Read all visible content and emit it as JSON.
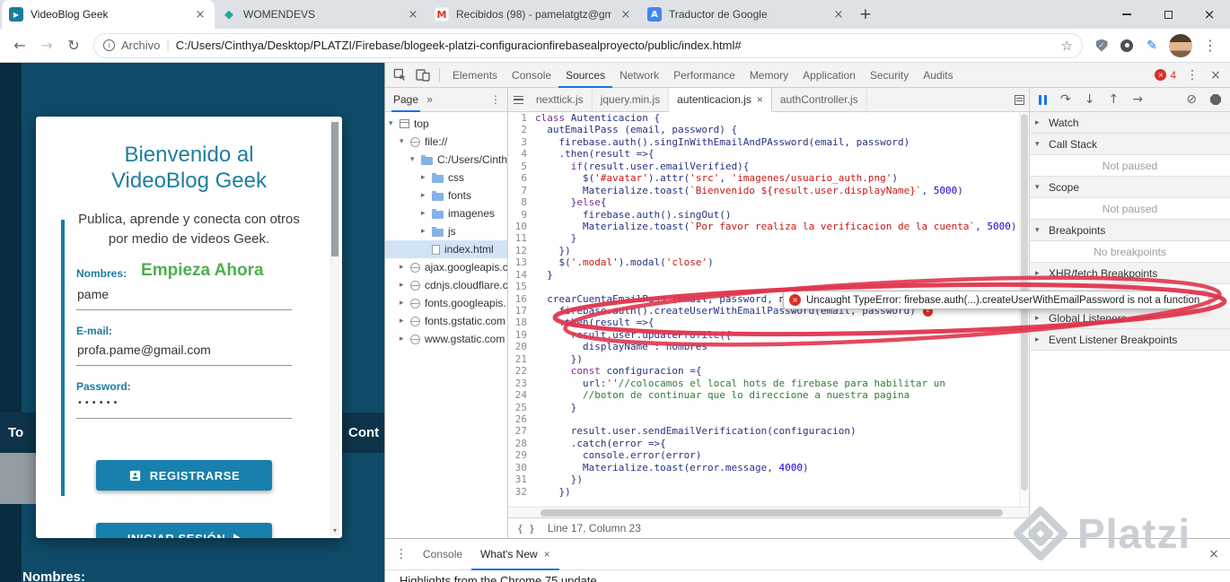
{
  "icons": {
    "back": "←",
    "forward": "→",
    "reload": "↻",
    "info": "i",
    "star": "☆",
    "kebab": "⋮",
    "cross": "×",
    "new_tab": "+",
    "overflow": "»",
    "separator": "|",
    "step_over": "↷",
    "step_into": "↓",
    "step_out": "↑",
    "step": "→",
    "deactivate": "⊘",
    "scroll_down": "▾"
  },
  "browser": {
    "tabs": [
      {
        "title": "VideoBlog Geek",
        "favicon": "videoblog",
        "glyph": "▶",
        "active": true,
        "close": "×"
      },
      {
        "title": "WOMENDEVS",
        "favicon": "womendevs",
        "glyph": "◆",
        "close": "×"
      },
      {
        "title": "Recibidos (98) - pamelatgtz@gm",
        "favicon": "gmail",
        "glyph": "M",
        "close": "×"
      },
      {
        "title": "Traductor de Google",
        "favicon": "translate",
        "glyph": "A",
        "close": "×"
      }
    ],
    "nav": {
      "scheme_label": "Archivo",
      "url": "C:/Users/Cinthya/Desktop/PLATZI/Firebase/blogeek-platzi-configuracionfirebasealproyecto/public/index.html#"
    }
  },
  "page": {
    "card": {
      "title": "Bienvenido al VideoBlog Geek",
      "subtitle": "Publica, aprende y conecta con otros por medio de videos Geek.",
      "form_heading": "Empieza Ahora",
      "nombres_label": "Nombres:",
      "nombres_value": "pame",
      "email_label": "E-mail:",
      "email_value": "profa.pame@gmail.com",
      "password_label": "Password:",
      "password_value": "••••••",
      "register_button": "REGISTRARSE",
      "login_button": "INICIAR SESIÓN"
    },
    "banners": {
      "left": "To",
      "right": "Cont",
      "bottom": "Nombres:"
    }
  },
  "devtools": {
    "main_tabs": [
      {
        "label": "Elements"
      },
      {
        "label": "Console"
      },
      {
        "label": "Sources",
        "active": true
      },
      {
        "label": "Network"
      },
      {
        "label": "Performance"
      },
      {
        "label": "Memory"
      },
      {
        "label": "Application"
      },
      {
        "label": "Security"
      },
      {
        "label": "Audits"
      }
    ],
    "error_count": "4",
    "navigator": {
      "pane_tab": "Page",
      "tree": [
        {
          "label": "top",
          "indent": 0,
          "arrow": "▾",
          "icon": "frame"
        },
        {
          "label": "file://",
          "indent": 1,
          "arrow": "▾",
          "icon": "domain"
        },
        {
          "label": "C:/Users/Cinthya",
          "indent": 2,
          "arrow": "▾",
          "icon": "folder"
        },
        {
          "label": "css",
          "indent": 3,
          "arrow": "▸",
          "icon": "folder"
        },
        {
          "label": "fonts",
          "indent": 3,
          "arrow": "▸",
          "icon": "folder"
        },
        {
          "label": "imagenes",
          "indent": 3,
          "arrow": "▸",
          "icon": "folder"
        },
        {
          "label": "js",
          "indent": 3,
          "arrow": "▸",
          "icon": "folder"
        },
        {
          "label": "index.html",
          "indent": 3,
          "arrow": "",
          "icon": "file",
          "selected": true
        },
        {
          "label": "ajax.googleapis.c...",
          "indent": 1,
          "arrow": "▸",
          "icon": "domain"
        },
        {
          "label": "cdnjs.cloudflare.c...",
          "indent": 1,
          "arrow": "▸",
          "icon": "domain"
        },
        {
          "label": "fonts.googleapis....",
          "indent": 1,
          "arrow": "▸",
          "icon": "domain"
        },
        {
          "label": "fonts.gstatic.com",
          "indent": 1,
          "arrow": "▸",
          "icon": "domain"
        },
        {
          "label": "www.gstatic.com",
          "indent": 1,
          "arrow": "▸",
          "icon": "domain"
        }
      ]
    },
    "editor": {
      "tabs": [
        {
          "label": "nexttick.js"
        },
        {
          "label": "jquery.min.js"
        },
        {
          "label": "autenticacion.js",
          "active": true,
          "close": "×"
        },
        {
          "label": "authController.js"
        }
      ],
      "error_line": 17,
      "lines": [
        "class Autenticacion {",
        "  autEmailPass (email, password) {",
        "    firebase.auth().singInWithEmailAndPAssword(email, password)",
        "    .then(result =>{",
        "      if(result.user.emailVerified){",
        "        $('#avatar').attr('src', 'imagenes/usuario_auth.png')",
        "        Materialize.toast(`Bienvenido ${result.user.displayName}`, 5000)",
        "      }else{",
        "        firebase.auth().singOut()",
        "        Materialize.toast(`Por favor realiza la verificacion de la cuenta`, 5000)",
        "      }",
        "    })",
        "    $('.modal').modal('close')",
        "  }",
        "",
        "  crearCuentaEmailPass (email, password, nombres) {",
        "    firebase.auth().createUserWithEmailPassword(email, password)",
        "    .then(result =>{",
        "      result.user.updateProfile({",
        "        displayName : nombres",
        "      })",
        "      const configuracion ={",
        "        url:''//colocamos el local hots de firebase para habilitar un",
        "        //boton de continuar que lo direccione a nuestra pagina",
        "      }",
        "",
        "      result.user.sendEmailVerification(configuracion)",
        "      .catch(error =>{",
        "        console.error(error)",
        "        Materialize.toast(error.message, 4000)",
        "      })",
        "    })"
      ],
      "status": {
        "braces": "{ }",
        "position": "Line 17, Column 23"
      }
    },
    "tooltip": {
      "text": "Uncaught TypeError: firebase.auth(...).createUserWithEmailPassword is not a function"
    },
    "debugger": {
      "sections": [
        {
          "label": "Watch",
          "arrow": "▸",
          "content": ""
        },
        {
          "label": "Call Stack",
          "arrow": "▾",
          "content": "Not paused"
        },
        {
          "label": "Scope",
          "arrow": "▾",
          "content": "Not paused"
        },
        {
          "label": "Breakpoints",
          "arrow": "▾",
          "content": "No breakpoints"
        },
        {
          "label": "XHR/fetch Breakpoints",
          "arrow": "▸",
          "content": ""
        },
        {
          "label": "Global Listeners",
          "arrow": "▸",
          "content": ""
        },
        {
          "label": "Event Listener Breakpoints",
          "arrow": "▸",
          "content": ""
        }
      ]
    },
    "drawer": {
      "tabs": [
        {
          "label": "Console"
        },
        {
          "label": "What's New",
          "active": true,
          "close": "×"
        }
      ],
      "content": "Highlights from the Chrome 75 update"
    }
  },
  "watermark": {
    "text": "Platzi"
  }
}
